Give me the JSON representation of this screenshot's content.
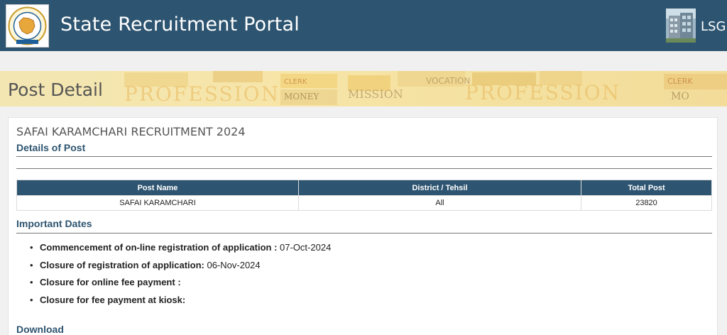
{
  "header": {
    "title": "State Recruitment Portal",
    "dept_label": "LSG"
  },
  "banner": {
    "title": "Post Detail"
  },
  "recruitment": {
    "title": "SAFAI KARAMCHARI RECRUITMENT 2024",
    "details_heading": "Details of Post",
    "table": {
      "columns": [
        "Post Name",
        "District / Tehsil",
        "Total Post"
      ],
      "rows": [
        {
          "post_name": "SAFAI KARAMCHARI",
          "district": "All",
          "total": "23820"
        }
      ]
    },
    "dates_heading": "Important Dates",
    "dates": [
      {
        "label": "Commencement of on-line registration of application :",
        "value": " 07-Oct-2024"
      },
      {
        "label": "Closure of registration of application:",
        "value": " 06-Nov-2024"
      },
      {
        "label": "Closure for online fee payment :",
        "value": ""
      },
      {
        "label": "Closure for fee payment at kiosk:",
        "value": ""
      }
    ],
    "download_heading": "Download"
  },
  "colors": {
    "header_bg": "#2d5470",
    "table_header_bg": "#2d5470",
    "section_heading": "#2d5470"
  },
  "icons": {
    "logo": "state-emblem-logo",
    "dept": "building-photo-icon"
  }
}
